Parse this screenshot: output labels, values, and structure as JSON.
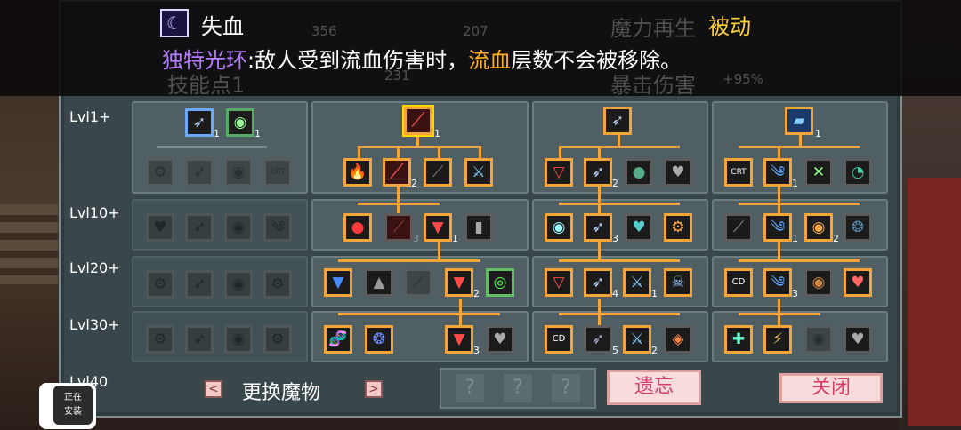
{
  "tooltip": {
    "skill_name": "失血",
    "skill_type": "被动",
    "desc_aura": "独特光环",
    "desc_sep": ":",
    "desc_part1": "敌人受到流血伤害时，",
    "desc_bleed": "流血",
    "desc_part2": "层数不会被移除。",
    "ghost_stat1": "356",
    "ghost_stat2": "207",
    "ghost_mana": "魔力再生",
    "ghost_skillpts": "技能点1",
    "ghost_stat3": "231",
    "ghost_crit": "暴击伤害",
    "ghost_crit_val": "+95%"
  },
  "levels": [
    "Lvl1+",
    "Lvl10+",
    "Lvl20+",
    "Lvl30+",
    "Lvl40"
  ],
  "icons": {
    "moon": "☾",
    "feather": "➶",
    "slash": "⟋",
    "fire": "🔥",
    "sword": "⚔",
    "heart": "♥",
    "orb": "◉",
    "skull": "☠",
    "dna": "🧬",
    "fish": "❂",
    "crt": "CRT",
    "cd": "CD",
    "gear": "⚙",
    "wind": "༄"
  },
  "tree": {
    "col1_counts": [
      "1",
      "1",
      "2",
      "3",
      "4",
      "4",
      "5",
      "5"
    ],
    "col2_counts": [
      "1",
      "2",
      "3",
      "1",
      "2",
      "3"
    ],
    "col3_counts": [
      "2",
      "3",
      "4",
      "1",
      "5",
      "2"
    ],
    "col4_counts": [
      "1",
      "1",
      "1",
      "2",
      "1",
      "3"
    ]
  },
  "bottom": {
    "swap_label": "更换魔物",
    "left_arrow": "<",
    "right_arrow": ">",
    "unknown": "?",
    "forget_btn": "遗忘",
    "close_btn": "关闭"
  },
  "install_badge": {
    "line1": "正在",
    "line2": "安装"
  }
}
